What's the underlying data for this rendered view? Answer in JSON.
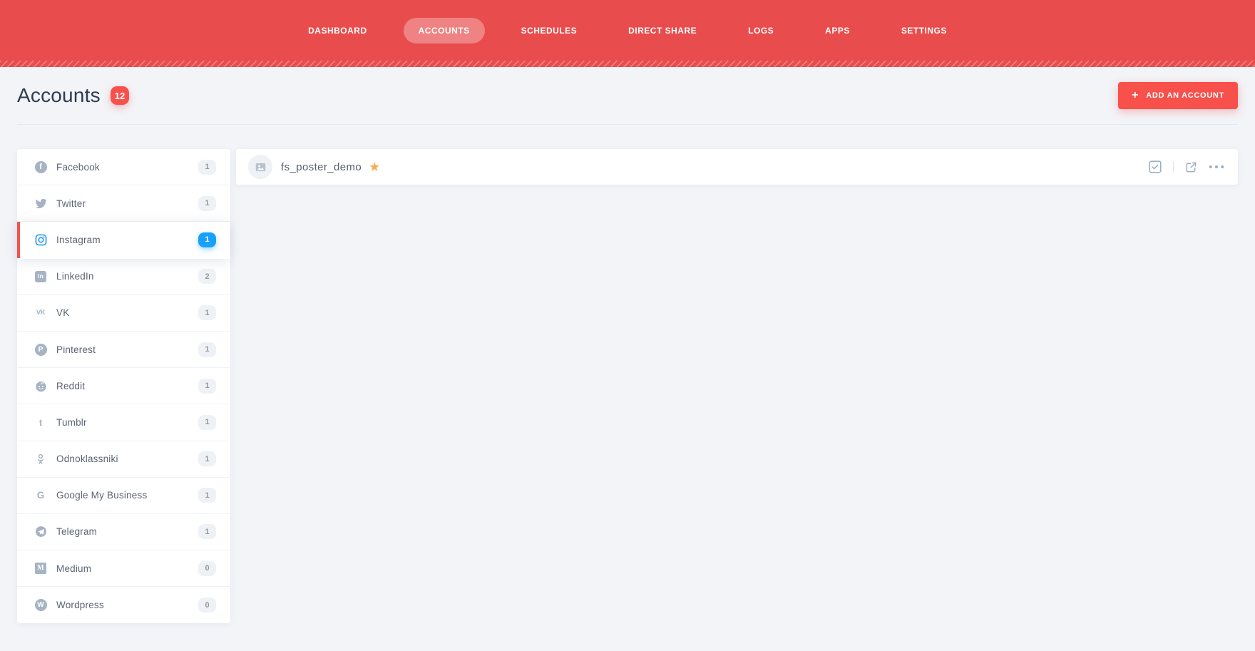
{
  "nav": {
    "items": [
      {
        "label": "DASHBOARD",
        "active": false
      },
      {
        "label": "ACCOUNTS",
        "active": true
      },
      {
        "label": "SCHEDULES",
        "active": false
      },
      {
        "label": "DIRECT SHARE",
        "active": false
      },
      {
        "label": "LOGS",
        "active": false
      },
      {
        "label": "APPS",
        "active": false
      },
      {
        "label": "SETTINGS",
        "active": false
      }
    ]
  },
  "header": {
    "title": "Accounts",
    "count": "12",
    "add_button_label": "ADD AN ACCOUNT",
    "plus_glyph": "+"
  },
  "sidebar": {
    "items": [
      {
        "label": "Facebook",
        "count": "1",
        "icon": "facebook-icon",
        "style": "circle",
        "glyph": "f",
        "active": false
      },
      {
        "label": "Twitter",
        "count": "1",
        "icon": "twitter-icon",
        "style": "svg",
        "glyph": "",
        "active": false
      },
      {
        "label": "Instagram",
        "count": "1",
        "icon": "instagram-icon",
        "style": "svg",
        "glyph": "",
        "active": true
      },
      {
        "label": "LinkedIn",
        "count": "2",
        "icon": "linkedin-icon",
        "style": "square",
        "glyph": "in",
        "active": false
      },
      {
        "label": "VK",
        "count": "1",
        "icon": "vk-icon",
        "style": "text",
        "glyph": "VK",
        "active": false
      },
      {
        "label": "Pinterest",
        "count": "1",
        "icon": "pinterest-icon",
        "style": "circle",
        "glyph": "P",
        "active": false
      },
      {
        "label": "Reddit",
        "count": "1",
        "icon": "reddit-icon",
        "style": "svg",
        "glyph": "",
        "active": false
      },
      {
        "label": "Tumblr",
        "count": "1",
        "icon": "tumblr-icon",
        "style": "text",
        "glyph": "t",
        "active": false
      },
      {
        "label": "Odnoklassniki",
        "count": "1",
        "icon": "odnoklassniki-icon",
        "style": "svg",
        "glyph": "",
        "active": false
      },
      {
        "label": "Google My Business",
        "count": "1",
        "icon": "google-icon",
        "style": "text",
        "glyph": "G",
        "active": false
      },
      {
        "label": "Telegram",
        "count": "1",
        "icon": "telegram-icon",
        "style": "svg",
        "glyph": "",
        "active": false
      },
      {
        "label": "Medium",
        "count": "0",
        "icon": "medium-icon",
        "style": "square",
        "glyph": "M",
        "active": false
      },
      {
        "label": "Wordpress",
        "count": "0",
        "icon": "wordpress-icon",
        "style": "circle",
        "glyph": "W",
        "active": false
      }
    ]
  },
  "accounts_list": [
    {
      "name": "fs_poster_demo",
      "favorite_glyph": "★"
    }
  ],
  "colors": {
    "nav_red": "#e94c4c",
    "accent_red": "#f8504b",
    "active_blue": "#18a0fb",
    "instagram_blue": "#2f9ff0",
    "star_orange": "#f6ae55",
    "page_background": "#f2f4f8"
  }
}
